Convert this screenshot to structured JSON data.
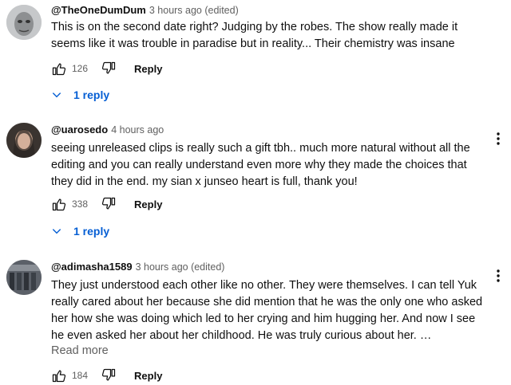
{
  "comments": [
    {
      "author": "@TheOneDumDum",
      "time": "3 hours ago (edited)",
      "text": "This is on the second date right? Judging by the robes. The show really made it seems like it was trouble in paradise but in reality... Their chemistry was insane",
      "likes": "126",
      "reply_label": "Reply",
      "replies_label": "1 reply"
    },
    {
      "author": "@uarosedo",
      "time": "4 hours ago",
      "text": "seeing unreleased clips is really such a gift tbh.. much more natural without all the editing and you can really understand even more why they made the choices that they did in the end. my sian x junseo heart is full, thank you!",
      "likes": "338",
      "reply_label": "Reply",
      "replies_label": "1 reply"
    },
    {
      "author": "@adimasha1589",
      "time": "3 hours ago (edited)",
      "text": "They just understood each other like no other. They were themselves. I can tell Yuk really cared about her because she did mention that he was the only one who asked her how she was doing which led to her crying and him hugging her. And now I see he even asked her about her childhood. He was truly curious about her. …",
      "read_more": "Read more",
      "likes": "184",
      "reply_label": "Reply"
    }
  ],
  "icons": {
    "like": "thumbs-up-outline-icon",
    "dislike": "thumbs-down-outline-icon",
    "more": "vertical-dots-icon",
    "expand": "chevron-down-icon"
  },
  "colors": {
    "link": "#065fd4",
    "muted": "#606060",
    "text": "#0f0f0f"
  }
}
